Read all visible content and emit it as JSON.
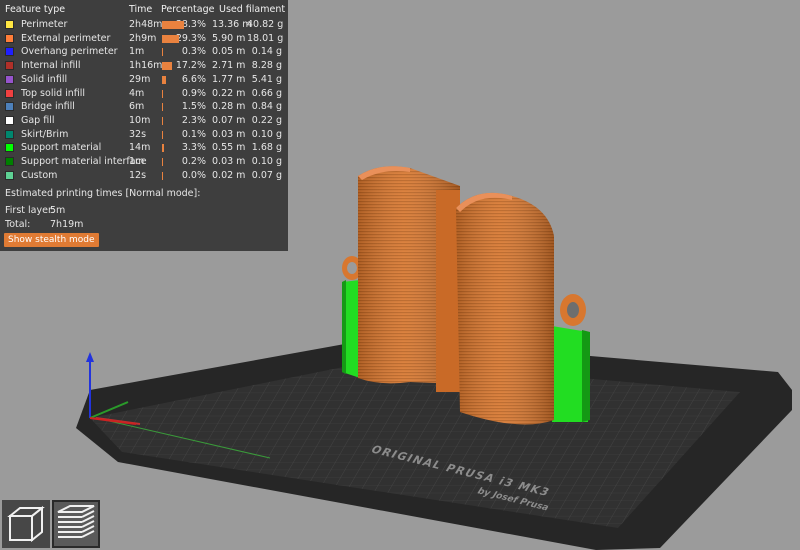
{
  "legend": {
    "headers": {
      "feature": "Feature type",
      "time": "Time",
      "percentage": "Percentage",
      "filament": "Used filament"
    },
    "rows": [
      {
        "name": "Perimeter",
        "time": "2h48m",
        "pct": "38.3%",
        "len": "13.36 m",
        "wt": "40.82 g",
        "color": "#ffe642",
        "fraction": 0.383
      },
      {
        "name": "External perimeter",
        "time": "2h9m",
        "pct": "29.3%",
        "len": "5.90 m",
        "wt": "18.01 g",
        "color": "#ff7d38",
        "fraction": 0.293
      },
      {
        "name": "Overhang perimeter",
        "time": "1m",
        "pct": "0.3%",
        "len": "0.05 m",
        "wt": "0.14 g",
        "color": "#1f1fff",
        "fraction": 0.003
      },
      {
        "name": "Internal infill",
        "time": "1h16m",
        "pct": "17.2%",
        "len": "2.71 m",
        "wt": "8.28 g",
        "color": "#b03029",
        "fraction": 0.172
      },
      {
        "name": "Solid infill",
        "time": "29m",
        "pct": "6.6%",
        "len": "1.77 m",
        "wt": "5.41 g",
        "color": "#9654cc",
        "fraction": 0.066
      },
      {
        "name": "Top solid infill",
        "time": "4m",
        "pct": "0.9%",
        "len": "0.22 m",
        "wt": "0.66 g",
        "color": "#f04040",
        "fraction": 0.009
      },
      {
        "name": "Bridge infill",
        "time": "6m",
        "pct": "1.5%",
        "len": "0.28 m",
        "wt": "0.84 g",
        "color": "#4d80ba",
        "fraction": 0.015
      },
      {
        "name": "Gap fill",
        "time": "10m",
        "pct": "2.3%",
        "len": "0.07 m",
        "wt": "0.22 g",
        "color": "#ffffff",
        "fraction": 0.023
      },
      {
        "name": "Skirt/Brim",
        "time": "32s",
        "pct": "0.1%",
        "len": "0.03 m",
        "wt": "0.10 g",
        "color": "#00876e",
        "fraction": 0.001
      },
      {
        "name": "Support material",
        "time": "14m",
        "pct": "3.3%",
        "len": "0.55 m",
        "wt": "1.68 g",
        "color": "#00ff00",
        "fraction": 0.033
      },
      {
        "name": "Support material interface",
        "time": "1m",
        "pct": "0.2%",
        "len": "0.03 m",
        "wt": "0.10 g",
        "color": "#008000",
        "fraction": 0.002
      },
      {
        "name": "Custom",
        "time": "12s",
        "pct": "0.0%",
        "len": "0.02 m",
        "wt": "0.07 g",
        "color": "#5ed194",
        "fraction": 0.0
      }
    ],
    "estimated_label": "Estimated printing times [Normal mode]:",
    "first_layer_label": "First layer:",
    "first_layer_value": "5m",
    "total_label": "Total:",
    "total_value": "7h19m",
    "stealth_button_label": "Show stealth mode"
  },
  "bed": {
    "brand_line1": "ORIGINAL PRUSA i3 MK3",
    "brand_line2": "by Josef Prusa"
  },
  "view_toolbar": {
    "icons": [
      "3d-view-icon",
      "preview-layers-icon"
    ]
  },
  "colors": {
    "model_orange": "#d97a34",
    "support_green": "#22e022",
    "bed_dark": "#2e2e2e",
    "accent_orange": "#e07b34"
  }
}
